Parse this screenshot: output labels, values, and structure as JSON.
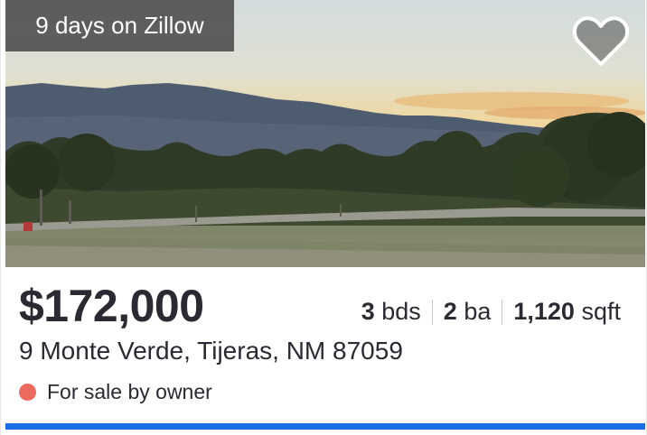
{
  "listing": {
    "days_badge": "9 days on Zillow",
    "price": "$172,000",
    "beds_num": "3",
    "beds_unit": "bds",
    "baths_num": "2",
    "baths_unit": "ba",
    "sqft_num": "1,120",
    "sqft_unit": "sqft",
    "address": "9 Monte Verde, Tijeras, NM 87059",
    "status_text": "For sale by owner",
    "status_color": "#ec6a5e",
    "saved": false
  },
  "colors": {
    "accent_bar": "#1a6ee6",
    "text": "#2a2a33"
  },
  "icons": {
    "favorite": "heart-outline-icon",
    "status": "status-dot-icon"
  }
}
